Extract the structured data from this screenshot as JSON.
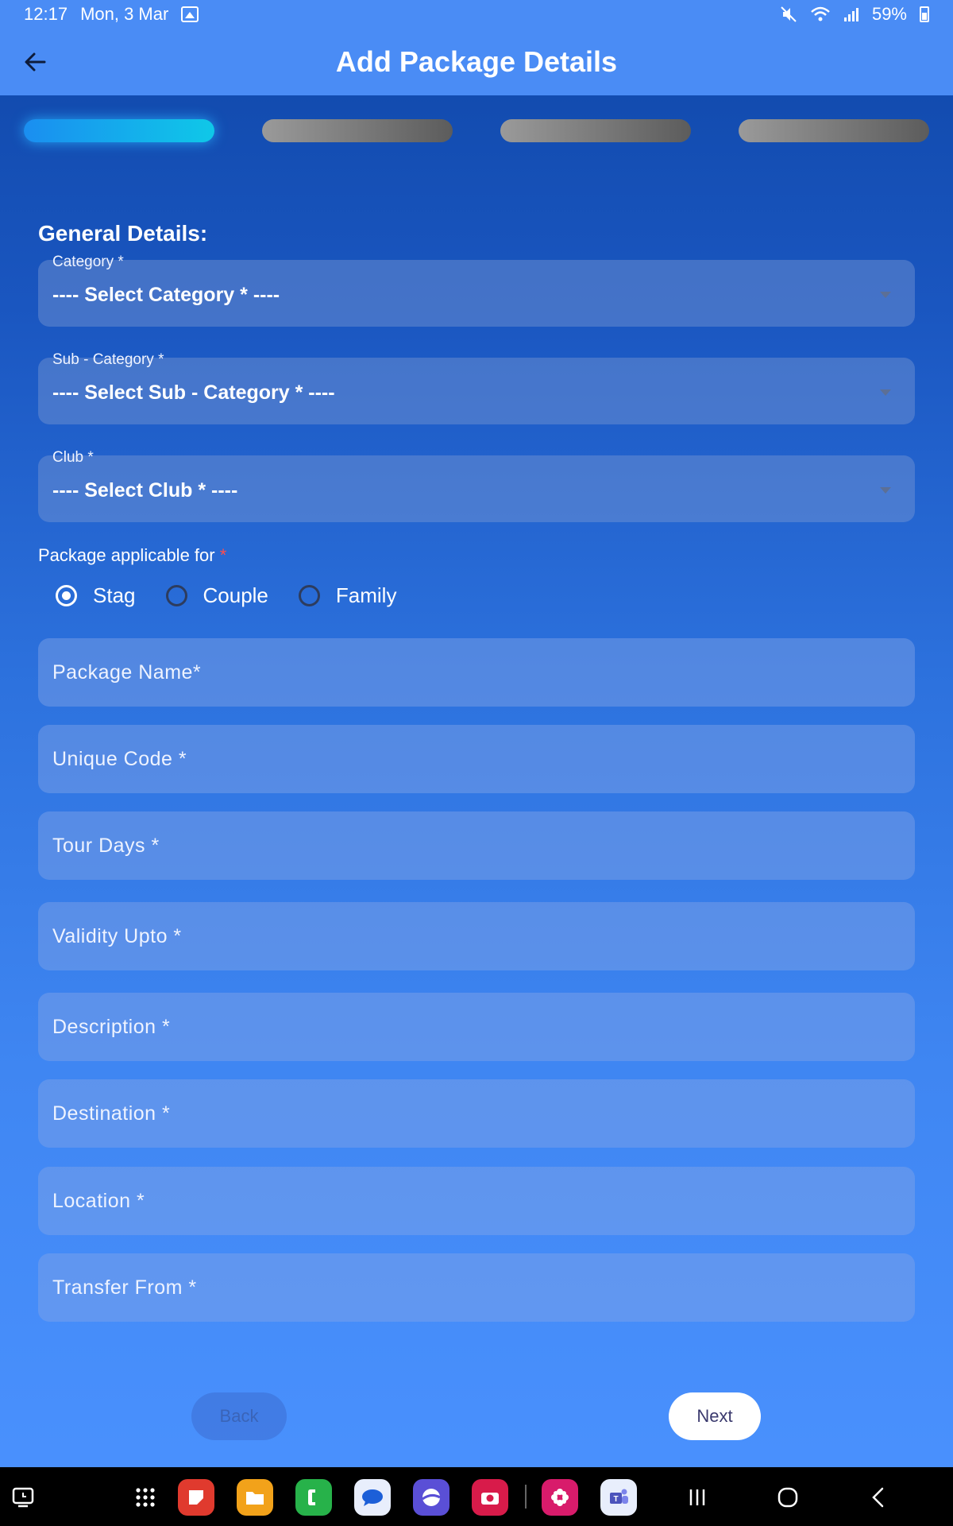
{
  "status_bar": {
    "time": "12:17",
    "date": "Mon, 3 Mar",
    "battery": "59%"
  },
  "app_bar": {
    "title": "Add Package Details"
  },
  "stepper": {
    "total_steps": 4,
    "active_step": 1
  },
  "form": {
    "section_title": "General Details:",
    "category": {
      "label": "Category *",
      "value": "---- Select Category * ----"
    },
    "sub_category": {
      "label": "Sub - Category *",
      "value": "---- Select Sub - Category * ----"
    },
    "club": {
      "label": "Club *",
      "value": "---- Select Club * ----"
    },
    "package_applicable": {
      "label": "Package applicable for",
      "star": "*",
      "options": [
        "Stag",
        "Couple",
        "Family"
      ],
      "selected": "Stag"
    },
    "fields": {
      "package_name": {
        "placeholder": "Package Name*"
      },
      "unique_code": {
        "placeholder": "Unique Code *"
      },
      "tour_days": {
        "placeholder": "Tour Days *"
      },
      "validity_upto": {
        "placeholder": "Validity Upto *"
      },
      "description": {
        "placeholder": "Description *"
      },
      "destination": {
        "placeholder": "Destination *"
      },
      "location": {
        "placeholder": "Location *"
      },
      "transfer_from": {
        "placeholder": "Transfer From *"
      }
    }
  },
  "buttons": {
    "back": "Back",
    "next": "Next"
  },
  "nav_bar": {
    "apps": [
      "recent-apps-icon",
      "app-drawer-icon",
      "notes-app-icon",
      "files-app-icon",
      "phone-app-icon",
      "messages-app-icon",
      "internet-app-icon",
      "camera-app-icon",
      "bixby-app-icon",
      "teams-app-icon"
    ],
    "system": [
      "recents-button",
      "home-button",
      "back-button"
    ]
  },
  "colors": {
    "app_bar": "#4a8cf5",
    "stepper_active": "#0fc8e8",
    "stepper_inactive": "#7a7a7a",
    "required": "#ff4d4d"
  }
}
